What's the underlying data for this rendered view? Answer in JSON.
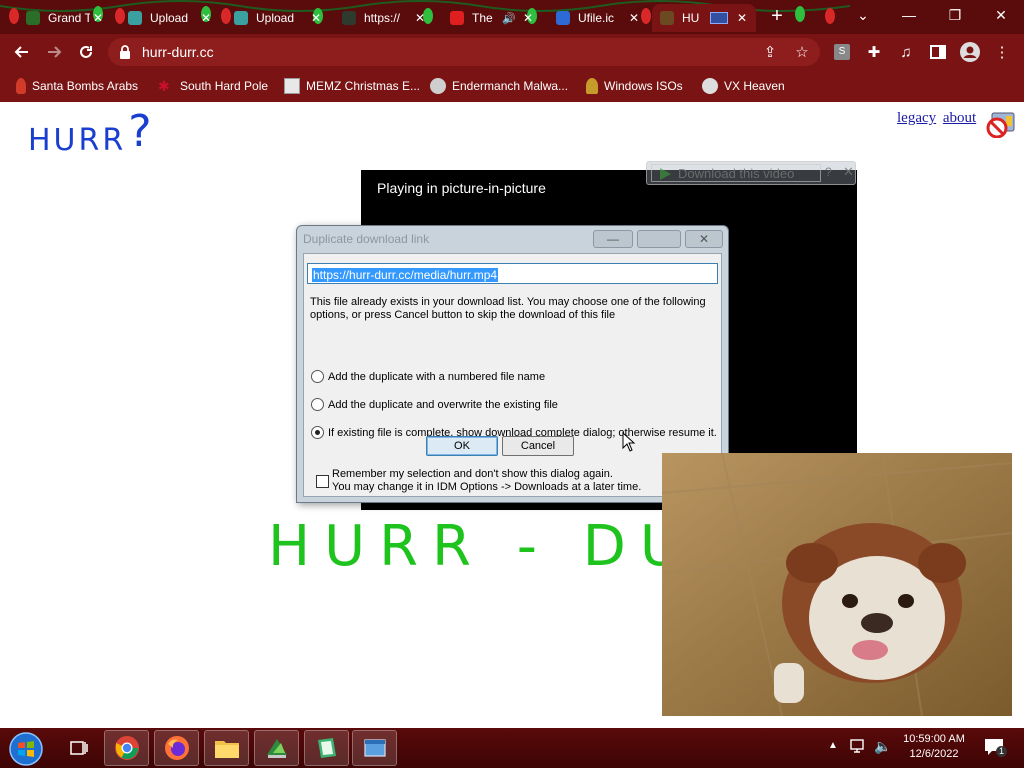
{
  "browser": {
    "tabs": [
      {
        "title": "Grand T",
        "favicon_color": "#2a6e2a",
        "active": false
      },
      {
        "title": "Upload",
        "favicon_color": "#3aa0a0",
        "active": false
      },
      {
        "title": "Upload",
        "favicon_color": "#3aa0a0",
        "active": false
      },
      {
        "title": "https://",
        "favicon_color": "#2f3a2f",
        "active": false
      },
      {
        "title": "The",
        "favicon_color": "#e02020",
        "active": false
      },
      {
        "title": "Ufile.ic",
        "favicon_color": "#2d6ad6",
        "active": false
      },
      {
        "title": "HU",
        "favicon_color": "#6b4a22",
        "active": true
      }
    ],
    "new_tab_glyph": "+",
    "window_controls": {
      "dropdown": "⌄",
      "minimize": "—",
      "restore": "❐",
      "close": "✕"
    },
    "url": "hurr-durr.cc",
    "extension_badge": "S",
    "bookmarks": [
      {
        "label": "Santa Bombs Arabs",
        "icon_color": "#d23a2a"
      },
      {
        "label": "South Hard Pole",
        "icon_color": "#c8102e"
      },
      {
        "label": "MEMZ Christmas E...",
        "icon_color": "#e8e8e8"
      },
      {
        "label": "Endermanch Malwa...",
        "icon_color": "#cfcfcf"
      },
      {
        "label": "Windows ISOs",
        "icon_color": "#c79b2b"
      },
      {
        "label": "VX Heaven",
        "icon_color": "#dddddd"
      }
    ]
  },
  "page": {
    "logo_text": "HURR",
    "logo_mark": "?",
    "links": [
      "legacy",
      "about"
    ],
    "big_title": "HURR - DU",
    "player_text": "Playing in picture-in-picture",
    "idm_button": "Download this video",
    "idm_help": "?",
    "idm_close": "✕"
  },
  "dialog": {
    "title": "Duplicate download link",
    "url": "https://hurr-durr.cc/media/hurr.mp4",
    "message": "This file already exists in your download list. You may choose one of the following options, or press Cancel button to skip the download of this file",
    "options": [
      {
        "label": "Add the duplicate with a numbered file name",
        "selected": false
      },
      {
        "label": "Add the duplicate and overwrite the existing file",
        "selected": false
      },
      {
        "label": "If existing file is complete, show download complete dialog; otherwise resume it.",
        "selected": true
      }
    ],
    "ok_label": "OK",
    "cancel_label": "Cancel",
    "remember_line1": "Remember my selection and don't show this dialog again.",
    "remember_line2": "You may change it in IDM Options -> Downloads at a later time.",
    "remember_checked": false
  },
  "taskbar": {
    "time": "10:59:00 AM",
    "date": "12/6/2022",
    "notification_count": "1"
  },
  "colors": {
    "chrome_theme": "#7a1414",
    "tabstrip": "#5a0b0b",
    "logo_blue": "#1a3fd0",
    "title_green": "#1ec31e"
  }
}
